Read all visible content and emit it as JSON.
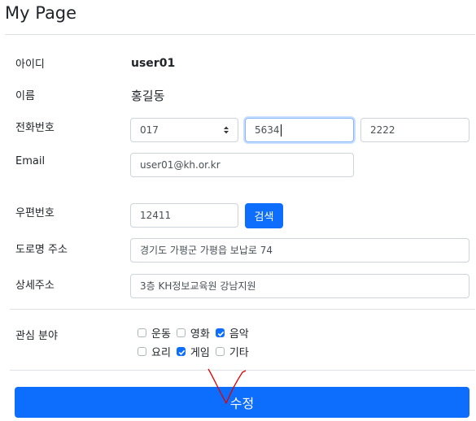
{
  "page": {
    "title": "My Page"
  },
  "form": {
    "id_label": "아이디",
    "id_value": "user01",
    "name_label": "이름",
    "name_value": "홍길동",
    "phone_label": "전화번호",
    "phone_prefix": "017",
    "phone_middle": "5634",
    "phone_last": "2222",
    "email_label": "Email",
    "email_value": "user01@kh.or.kr",
    "zip_label": "우편번호",
    "zip_value": "12411",
    "search_button": "검색",
    "road_label": "도로명 주소",
    "road_value": "경기도 가평군 가평읍 보납로 74",
    "detail_label": "상세주소",
    "detail_value": "3층 KH정보교육원 강남지원",
    "interest_label": "관심 분야",
    "interests": [
      {
        "label": "운동",
        "checked": false
      },
      {
        "label": "영화",
        "checked": false
      },
      {
        "label": "음악",
        "checked": true
      },
      {
        "label": "요리",
        "checked": false
      },
      {
        "label": "게임",
        "checked": true
      },
      {
        "label": "기타",
        "checked": false
      }
    ],
    "submit_button": "수정"
  },
  "colors": {
    "primary": "#0d6efd",
    "annotation": "#e00000"
  },
  "icons": [
    "select-arrows-icon",
    "checkbox-check-icon"
  ]
}
